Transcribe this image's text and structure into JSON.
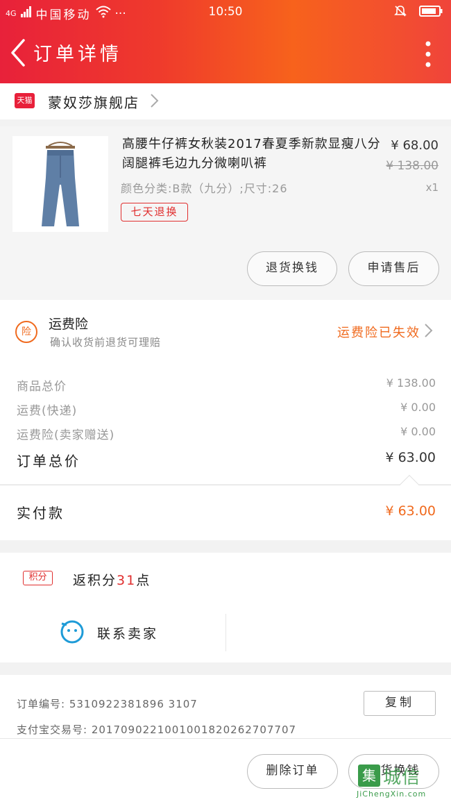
{
  "status_bar": {
    "carrier_signal": "4G",
    "carrier": "中国移动",
    "more": "···",
    "time": "10:50"
  },
  "nav": {
    "title": "订单详情"
  },
  "shop": {
    "badge": "天猫",
    "name": "蒙奴莎旗舰店"
  },
  "product": {
    "title": "高腰牛仔裤女秋装2017春夏季新款显瘦八分阔腿裤毛边九分微喇叭裤",
    "price": "¥ 68.00",
    "original_price": "¥ 138.00",
    "quantity": "x1",
    "sku": "颜色分类:B款（九分）;尺寸:26",
    "badge": "七天退换",
    "buttons": {
      "return_exchange": "退货换钱",
      "after_sales": "申请售后"
    }
  },
  "insurance": {
    "icon": "险",
    "title": "运费险",
    "subtitle": "确认收货前退货可理赔",
    "status": "运费险已失效"
  },
  "fees": {
    "rows": [
      {
        "label": "商品总价",
        "value": "¥ 138.00"
      },
      {
        "label": "运费(快递)",
        "value": "¥ 0.00"
      },
      {
        "label": "运费险(卖家赠送)",
        "value": "¥ 0.00"
      }
    ],
    "total_label": "订单总价",
    "total_value": "¥ 63.00"
  },
  "payment": {
    "label": "实付款",
    "value": "¥ 63.00"
  },
  "points": {
    "tag": "积分",
    "prefix": "返积分",
    "amount": "31",
    "suffix": "点"
  },
  "contact": {
    "label": "联系卖家"
  },
  "order_info": {
    "order_no": "订单编号:  5310922381896 3107",
    "alipay_no": "支付宝交易号:  2017090221001001820262707707",
    "copy": "复制"
  },
  "bottom": {
    "delete": "删除订单",
    "return_exchange": "退货换钱"
  },
  "watermark": {
    "logo": "集",
    "text": "城信",
    "url": "JiChengXin.com"
  },
  "colors": {
    "accent": "#f06a1e",
    "tmall_red": "#e8203a",
    "header_start": "#e8213a",
    "header_end": "#f7621c"
  }
}
